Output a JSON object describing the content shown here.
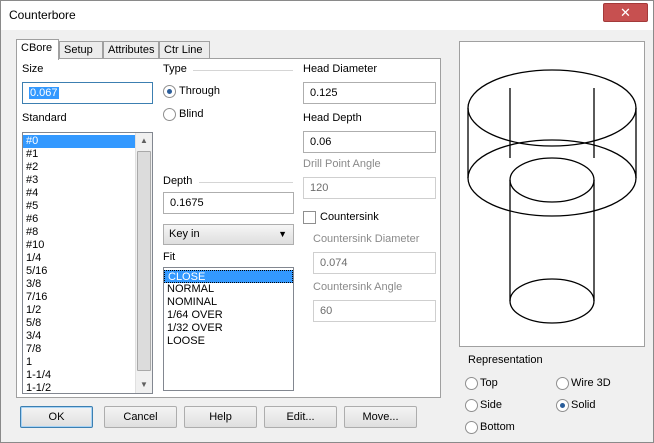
{
  "window": {
    "title": "Counterbore",
    "close_glyph": "✕"
  },
  "tabs": [
    "CBore",
    "Setup",
    "Attributes",
    "Ctr Line"
  ],
  "size": {
    "label": "Size",
    "value": "0.067"
  },
  "standard": {
    "label": "Standard",
    "items": [
      "#0",
      "#1",
      "#2",
      "#3",
      "#4",
      "#5",
      "#6",
      "#8",
      "#10",
      "1/4",
      "5/16",
      "3/8",
      "7/16",
      "1/2",
      "5/8",
      "3/4",
      "7/8",
      "1",
      "1-1/4",
      "1-1/2"
    ],
    "selected": "#0"
  },
  "type": {
    "label": "Type",
    "options": [
      {
        "label": "Through",
        "checked": true
      },
      {
        "label": "Blind",
        "checked": false
      }
    ]
  },
  "depth": {
    "label": "Depth",
    "value": "0.1675"
  },
  "mode_select": {
    "value": "Key in"
  },
  "fit": {
    "label": "Fit",
    "items": [
      "CLOSE",
      "NORMAL",
      "NOMINAL",
      "1/64 OVER",
      "1/32 OVER",
      "LOOSE"
    ],
    "selected": "CLOSE"
  },
  "head_diameter": {
    "label": "Head Diameter",
    "value": "0.125"
  },
  "head_depth": {
    "label": "Head Depth",
    "value": "0.06"
  },
  "drill_point_angle": {
    "label": "Drill Point Angle",
    "value": "120"
  },
  "countersink": {
    "label": "Countersink",
    "checked": false
  },
  "countersink_diameter": {
    "label": "Countersink Diameter",
    "value": "0.074"
  },
  "countersink_angle": {
    "label": "Countersink Angle",
    "value": "60"
  },
  "representation": {
    "label": "Representation",
    "options": [
      {
        "label": "Top",
        "checked": false
      },
      {
        "label": "Wire 3D",
        "checked": false
      },
      {
        "label": "Side",
        "checked": false
      },
      {
        "label": "Solid",
        "checked": true
      },
      {
        "label": "Bottom",
        "checked": false
      }
    ]
  },
  "buttons": {
    "ok": "OK",
    "cancel": "Cancel",
    "help": "Help",
    "edit": "Edit...",
    "move": "Move..."
  }
}
